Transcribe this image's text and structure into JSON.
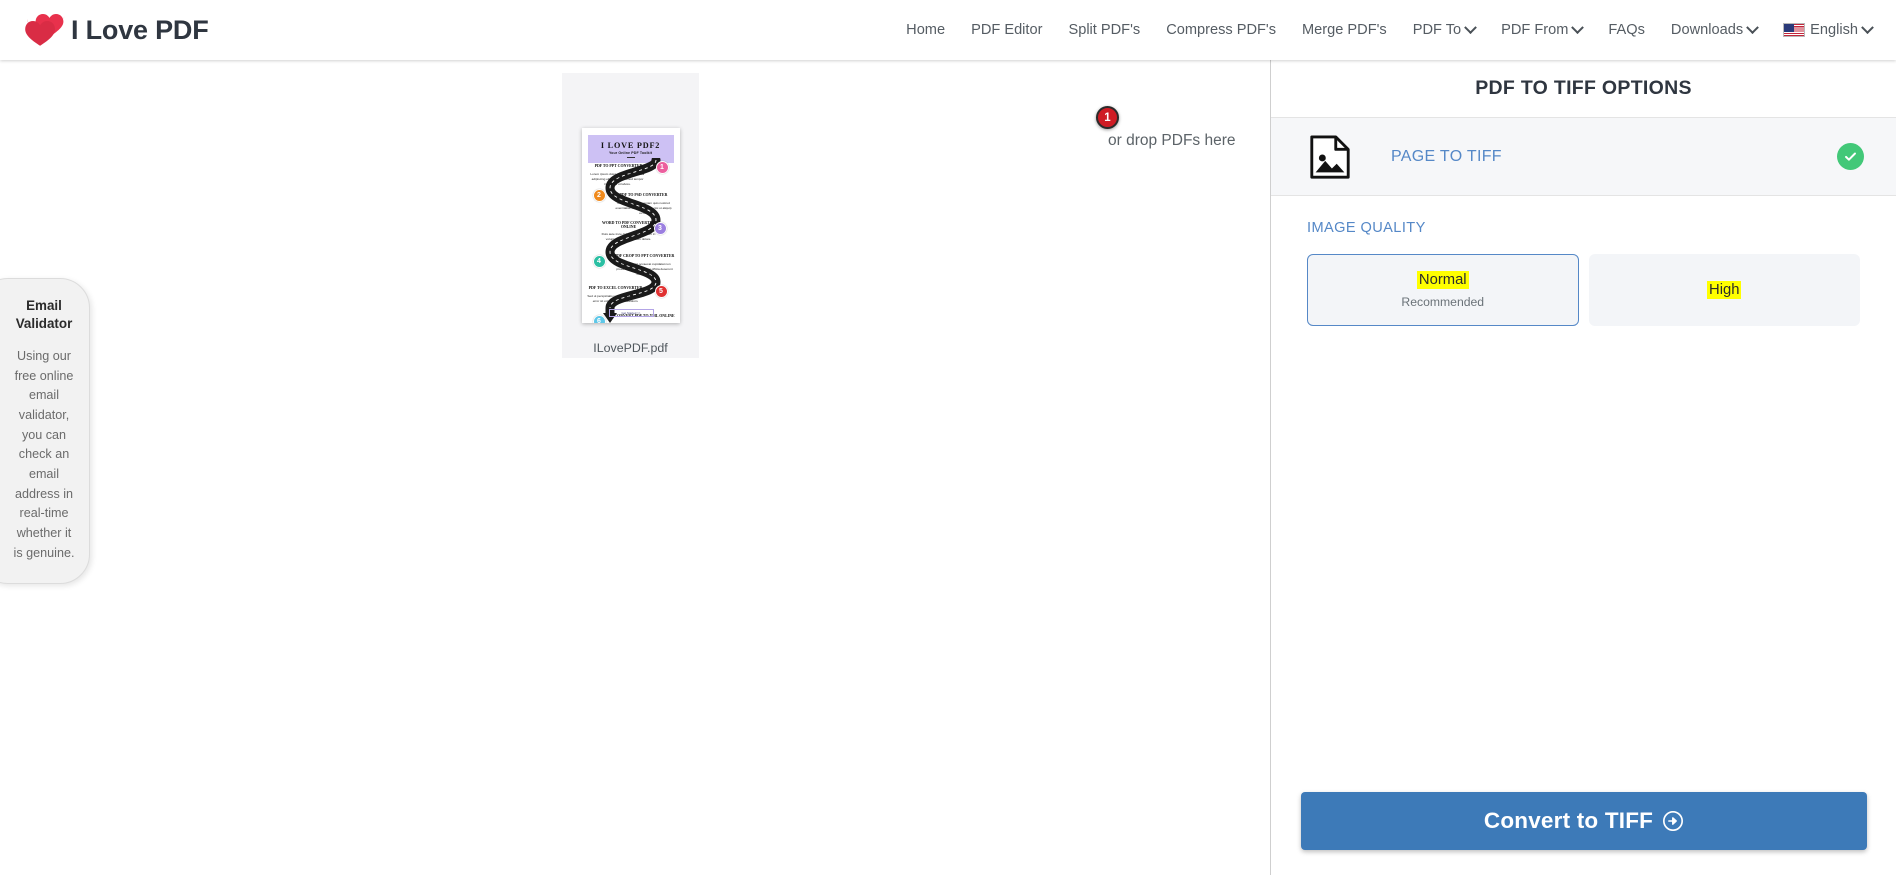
{
  "header": {
    "logo_text": "I Love PDF",
    "logo_icon": "hearts-logo-icon",
    "nav": [
      {
        "label": "Home",
        "caret": false
      },
      {
        "label": "PDF Editor",
        "caret": false
      },
      {
        "label": "Split PDF's",
        "caret": false
      },
      {
        "label": "Compress PDF's",
        "caret": false
      },
      {
        "label": "Merge PDF's",
        "caret": false
      },
      {
        "label": "PDF To",
        "caret": true
      },
      {
        "label": "PDF From",
        "caret": true
      },
      {
        "label": "FAQs",
        "caret": false
      },
      {
        "label": "Downloads",
        "caret": true
      }
    ],
    "language": {
      "label": "English",
      "flag_icon": "us-flag-icon",
      "caret": true
    }
  },
  "main": {
    "drop_hint": "or drop PDFs here",
    "file_count_badge": "1",
    "file": {
      "name": "ILovePDF.pdf",
      "thumbnail": {
        "title": "I LOVE PDF2",
        "subtitle": "Your Online PDF Toolkit",
        "button_label": "Get Started >>",
        "steps": [
          {
            "number": "1",
            "color": "#ec5f9e",
            "heading": "PDF TO PPT CONVERTER"
          },
          {
            "number": "2",
            "color": "#f08a1c",
            "heading": "PDF TO PSD CONVERTER"
          },
          {
            "number": "3",
            "color": "#9b7fe0",
            "heading": "WORD TO PDF CONVERTER ONLINE"
          },
          {
            "number": "4",
            "color": "#2bbfa3",
            "heading": "PDF CROP TO PPT CONVERTER"
          },
          {
            "number": "5",
            "color": "#e03131",
            "heading": "PDF TO EXCEL CONVERTER"
          },
          {
            "number": "6",
            "color": "#5ec7e8",
            "heading": "CONVERT PDF TO XML ONLINE"
          }
        ]
      }
    }
  },
  "side_widget": {
    "title": "Email Validator",
    "body": "Using our free online email validator, you can check an email address in real-time whether it is genuine."
  },
  "panel": {
    "title": "PDF TO TIFF OPTIONS",
    "option_row": {
      "label": "PAGE TO TIFF",
      "icon": "image-file-icon",
      "selected": true,
      "check_color": "#42c878"
    },
    "quality": {
      "label": "IMAGE QUALITY",
      "highlight_color": "#ffff00",
      "options": [
        {
          "label": "Normal",
          "sub": "Recommended",
          "selected": true
        },
        {
          "label": "High",
          "sub": "",
          "selected": false
        }
      ]
    },
    "convert_button": {
      "label": "Convert to TIFF",
      "icon": "arrow-right-circle-icon",
      "color": "#3d7ab8"
    }
  }
}
